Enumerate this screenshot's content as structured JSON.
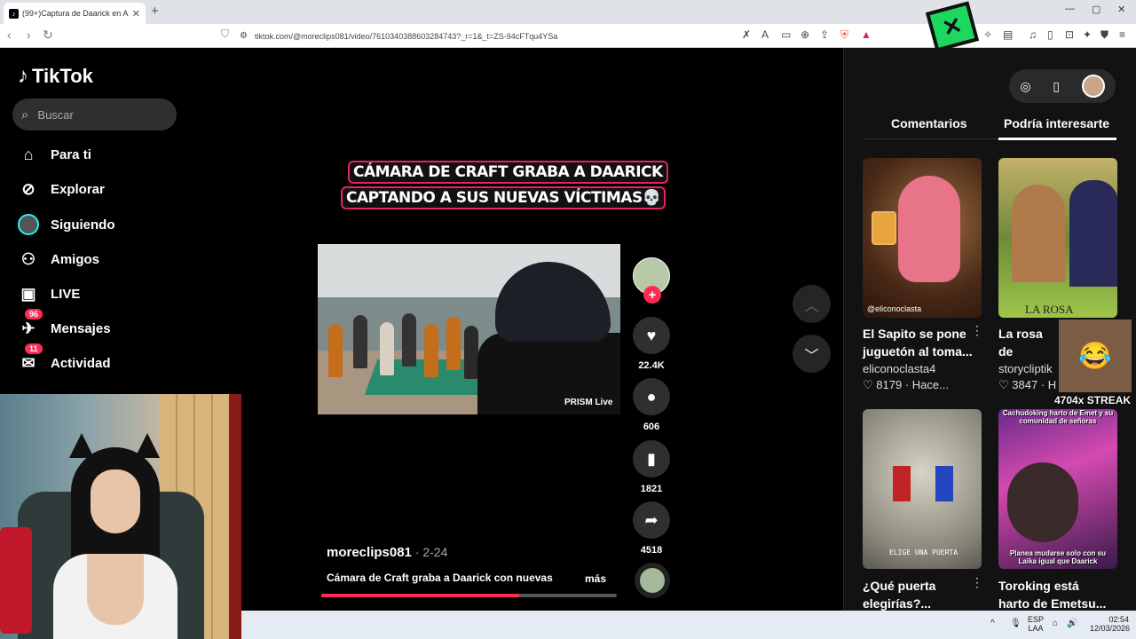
{
  "browser": {
    "tab_title": "(99+)Captura de Daarick en A",
    "url": "tiktok.com/@moreclips081/video/7610340388603284743?_r=1&_t=ZS-94cFTqu4YSa"
  },
  "sidebar": {
    "logo": "TikTok",
    "search_placeholder": "Buscar",
    "items": [
      {
        "label": "Para ti",
        "icon": "⌂"
      },
      {
        "label": "Explorar",
        "icon": "⊘"
      },
      {
        "label": "Siguiendo",
        "icon": "◉"
      },
      {
        "label": "Amigos",
        "icon": "⚇"
      },
      {
        "label": "LIVE",
        "icon": "▣"
      },
      {
        "label": "Mensajes",
        "icon": "✈",
        "badge": "96"
      },
      {
        "label": "Actividad",
        "icon": "✉",
        "badge": "11"
      }
    ]
  },
  "video": {
    "caption_line1": "CÁMARA DE CRAFT GRABA A DAARICK",
    "caption_line2": "CAPTANDO A SUS NUEVAS VÍCTIMAS💀",
    "watermark": "PRISM Live",
    "author": "moreclips081",
    "date": " · 2-24",
    "description": "Cámara de Craft graba a Daarick con nuevas",
    "more": "más",
    "progress": 0.67
  },
  "actions": {
    "likes": "22.4K",
    "comments": "606",
    "saves": "1821",
    "shares": "4518"
  },
  "overlay": {
    "streak": "4704x STREAK"
  },
  "panel": {
    "tabs": [
      "Comentarios",
      "Podría interesarte"
    ],
    "active_tab": 1,
    "videos": [
      {
        "title": "El Sapito se pone juguetón al toma...",
        "user": "eliconoclasta4",
        "likes": "8179",
        "time": "Hace...",
        "overlay": "@eliconoclasta"
      },
      {
        "title": "La rosa de Guadalupe",
        "user": "storycliptik",
        "likes": "3847",
        "time": "H",
        "overlay": "LA ROSA"
      },
      {
        "title": "¿Qué puerta elegirías?...",
        "overlay": "ELIGE UNA PUERTA"
      },
      {
        "title": "Toroking está harto de Emetsu...",
        "overlay_top": "Cachudoking harto de Emet y su comunidad de señoras",
        "overlay": "Planea mudarse solo con su Laika igual que Daarick"
      }
    ]
  },
  "taskbar": {
    "lang_top": "ESP",
    "lang_bottom": "LAA",
    "time": "02:54",
    "date": "12/03/2026"
  }
}
